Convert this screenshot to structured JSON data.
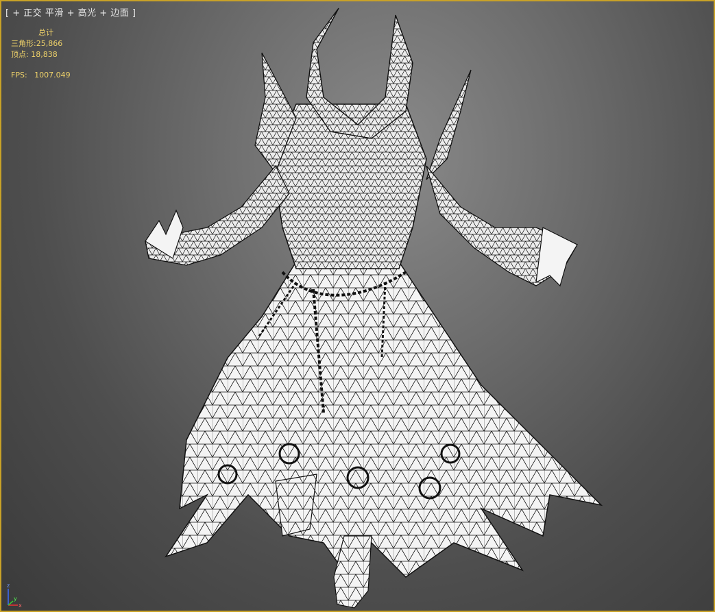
{
  "viewport": {
    "label_open": "[",
    "label_plus": "+",
    "label_view": "正交",
    "label_shading": "平滑",
    "label_highlight": "+ 高光",
    "label_edges": "+ 边面",
    "label_close": "]"
  },
  "stats": {
    "header": "总计",
    "triangles_label": "三角形:",
    "triangles_value": "25,866",
    "vertices_label": "顶点:",
    "vertices_value": "18,838",
    "fps_label": "FPS:",
    "fps_value": "1007.049"
  },
  "axis": {
    "z": "z",
    "x": "x",
    "y": "y"
  },
  "colors": {
    "viewport_border": "#c9a227",
    "stats_text": "#f0d36a",
    "mesh_fill": "#f4f4f4",
    "mesh_wire": "#111111"
  }
}
